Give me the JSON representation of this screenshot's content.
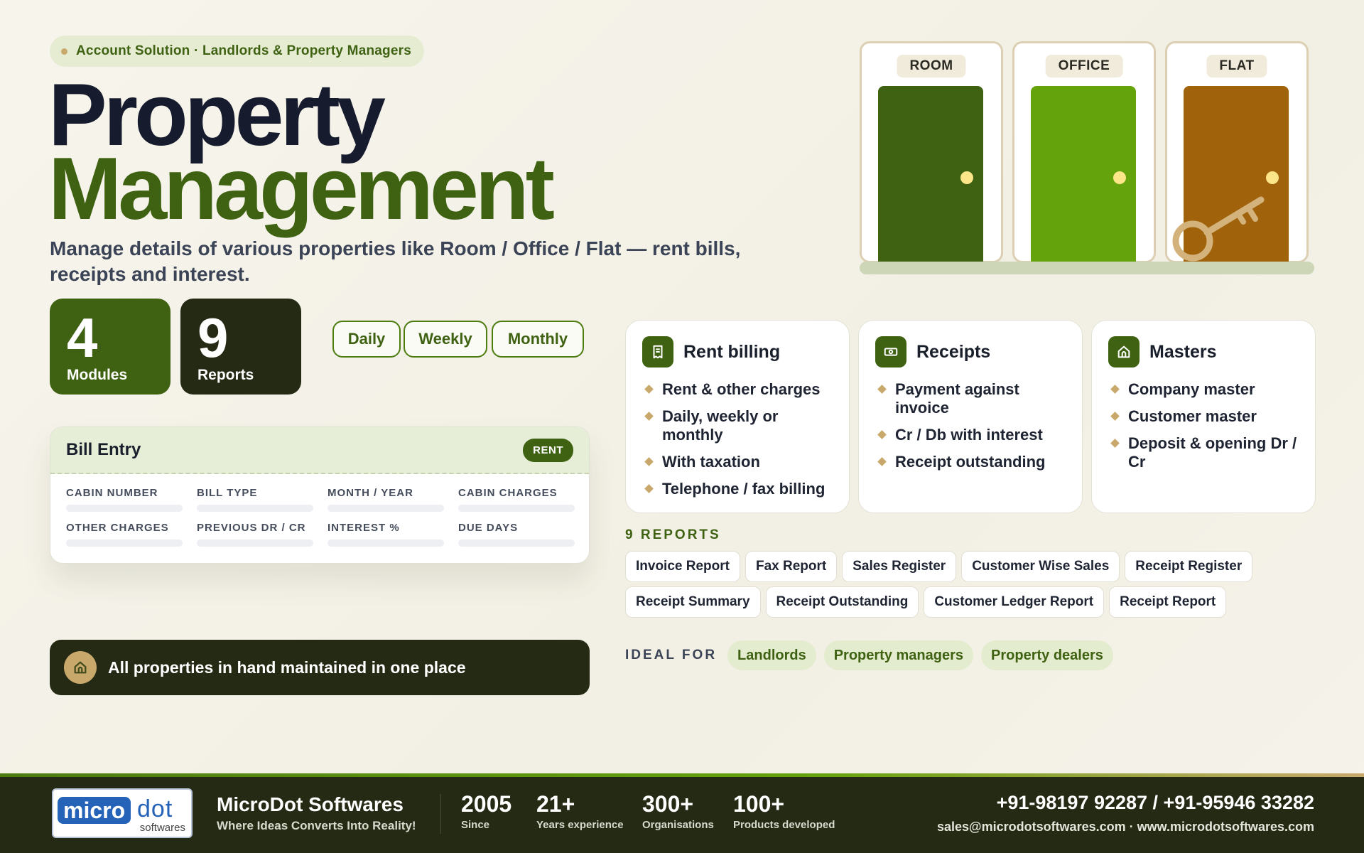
{
  "hero": {
    "tagline": "Account Solution · Landlords & Property Managers",
    "title_line1": "Property",
    "title_line2": "Management",
    "subtitle": "Manage details of various properties like Room / Office / Flat — rent bills, receipts and interest."
  },
  "stats": [
    {
      "value": "4",
      "label": "Modules"
    },
    {
      "value": "9",
      "label": "Reports"
    }
  ],
  "periods": [
    "Daily",
    "Weekly",
    "Monthly"
  ],
  "bill_entry": {
    "title": "Bill Entry",
    "badge": "RENT",
    "fields": [
      "CABIN NUMBER",
      "BILL TYPE",
      "MONTH / YEAR",
      "CABIN CHARGES",
      "OTHER CHARGES",
      "PREVIOUS DR / CR",
      "INTEREST %",
      "DUE DAYS"
    ]
  },
  "banner": {
    "text": "All properties in hand maintained in one place",
    "icon": "home-icon"
  },
  "doors": [
    {
      "label": "ROOM",
      "color": "#3f6212"
    },
    {
      "label": "OFFICE",
      "color": "#65a30d"
    },
    {
      "label": "FLAT",
      "color": "#a0620a"
    }
  ],
  "features": [
    {
      "title": "Rent billing",
      "icon": "receipt-icon",
      "items": [
        "Rent & other charges",
        "Daily, weekly or monthly",
        "With taxation",
        "Telephone / fax billing"
      ]
    },
    {
      "title": "Receipts",
      "icon": "cash-icon",
      "items": [
        "Payment against invoice",
        "Cr / Db with interest",
        "Receipt outstanding"
      ]
    },
    {
      "title": "Masters",
      "icon": "home-icon",
      "items": [
        "Company master",
        "Customer master",
        "Deposit & opening Dr / Cr"
      ]
    }
  ],
  "reports": {
    "heading": "9 REPORTS",
    "row1": [
      "Invoice Report",
      "Fax Report",
      "Sales Register",
      "Customer Wise Sales",
      "Receipt Register"
    ],
    "row2": [
      "Receipt Summary",
      "Receipt Outstanding",
      "Customer Ledger Report",
      "Receipt Report"
    ]
  },
  "ideal": {
    "heading": "IDEAL FOR",
    "items": [
      "Landlords",
      "Property managers",
      "Property dealers"
    ]
  },
  "footer": {
    "logo_micro": "micro",
    "logo_dot": "dot",
    "logo_sub": "softwares",
    "brand": "MicroDot Softwares",
    "brand_tagline": "Where Ideas Converts Into Reality!",
    "stats": [
      {
        "value": "2005",
        "label": "Since"
      },
      {
        "value": "21+",
        "label": "Years experience"
      },
      {
        "value": "300+",
        "label": "Organisations"
      },
      {
        "value": "100+",
        "label": "Products developed"
      }
    ],
    "phone": "+91-98197 92287 / +91-95946 33282",
    "contact": "sales@microdotsoftwares.com · www.microdotsoftwares.com"
  },
  "colors": {
    "brand_green": "#3f6212",
    "light_green": "#65a30d",
    "dark": "#252a14",
    "gold": "#c9a96b"
  }
}
